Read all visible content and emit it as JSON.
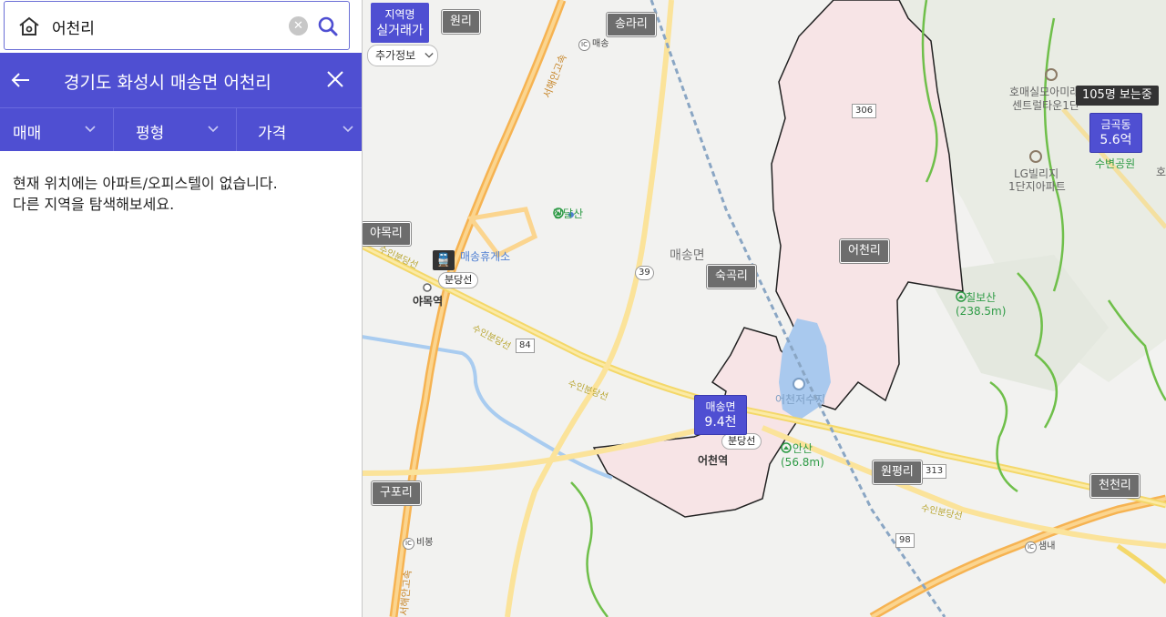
{
  "search": {
    "value": "어천리",
    "home_icon": "home-icon",
    "clear_icon": "clear-icon",
    "search_icon": "search-icon"
  },
  "header": {
    "title": "경기도 화성시 매송면 어천리",
    "back_icon": "arrow-left-icon",
    "close_icon": "close-icon"
  },
  "filters": [
    {
      "label": "매매"
    },
    {
      "label": "평형"
    },
    {
      "label": "가격"
    }
  ],
  "empty_message": "현재 위치에는 아파트/오피스텔이 없습니다.\n다른 지역을 탐색해보세요.",
  "map": {
    "toggle": {
      "line1": "지역명",
      "line2": "실거래가"
    },
    "extra_info": "추가정보",
    "chips": [
      "원리",
      "송라리",
      "야목리",
      "숙곡리",
      "어천리",
      "구포리",
      "원평리",
      "천천리"
    ],
    "places": {
      "maesong_myeon": "매송면",
      "hwy_name_1": "서해안고속",
      "hwy_name_2": "서해안고속",
      "rest_area": "매송휴게소",
      "station_yamok": "야목역",
      "station_eocheon": "어천역",
      "reservoir": "어천저수지",
      "apt1": "호매실모아미래",
      "apt1b": "센트럴타운1단",
      "apt2": "LG빌리지",
      "apt2b": "1단지아파트",
      "park": "수변공원",
      "ho": "호"
    },
    "mountains": [
      {
        "name": "장달산",
        "height": ""
      },
      {
        "name": "칠보산",
        "height": "(238.5m)"
      },
      {
        "name": "안산",
        "height": "(56.8m)"
      }
    ],
    "rail_labels": [
      "분당선",
      "분당선"
    ],
    "road_labels": [
      "수인분당선",
      "수인분당선",
      "수인분당선",
      "수인분당선"
    ],
    "shields": [
      "306",
      "39",
      "84",
      "313",
      "98"
    ],
    "ic_labels": [
      "매송",
      "비봉",
      "샘내"
    ],
    "markers": [
      {
        "name": "매송면",
        "value": "9.4천"
      },
      {
        "name": "금곡동",
        "value": "5.6억"
      }
    ],
    "viewers": "105명 보는중",
    "colors": {
      "accent": "#4f4fd2",
      "region_fill": "#f7e4e6",
      "highway": "#f6b352",
      "road": "#f6d878",
      "green_line": "#6fbf4a"
    }
  }
}
